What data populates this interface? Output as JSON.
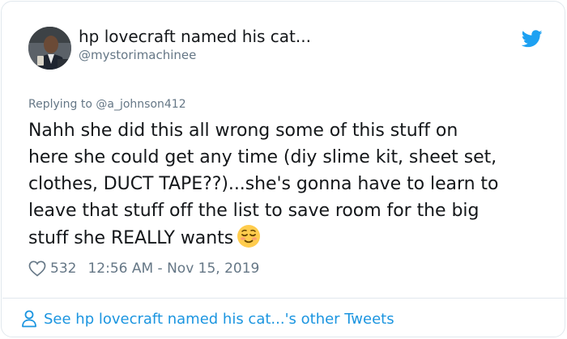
{
  "tweet": {
    "author": {
      "name": "hp lovecraft named his cat...",
      "handle": "@mystorimachinee"
    },
    "reply": {
      "prefix": "Replying to",
      "handle": "@a_johnson412"
    },
    "text_lines": [
      "Nahh she did this all wrong some of this stuff on",
      "here she could get any time (diy slime kit, sheet set,",
      "clothes, DUCT TAPE??)...she's gonna have to learn to",
      "leave that stuff off the list to save room for the big",
      "stuff she REALLY wants"
    ],
    "likes": "532",
    "timestamp": "12:56 AM - Nov 15, 2019",
    "more_tweets_link": "See hp lovecraft named his cat...'s other Tweets"
  },
  "icons": {
    "brand": "twitter-bird-icon",
    "emoji": "relieved-face-emoji",
    "like": "heart-outline-icon",
    "person": "person-outline-icon"
  },
  "colors": {
    "twitter_blue": "#1da1f2",
    "link_blue": "#1b95e0",
    "secondary_text": "#657786",
    "primary_text": "#14171a",
    "border": "#e1e8ed"
  }
}
